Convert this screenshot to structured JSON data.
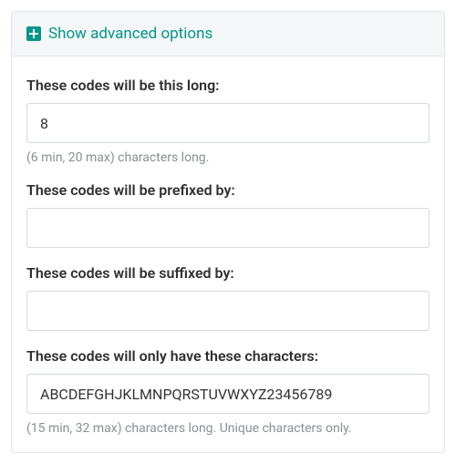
{
  "panel": {
    "toggle_label": "Show advanced options"
  },
  "fields": {
    "length": {
      "label": "These codes will be this long:",
      "value": "8",
      "help": "(6 min, 20 max) characters long."
    },
    "prefix": {
      "label": "These codes will be prefixed by:",
      "value": ""
    },
    "suffix": {
      "label": "These codes will be suffixed by:",
      "value": ""
    },
    "charset": {
      "label": "These codes will only have these characters:",
      "value": "ABCDEFGHJKLMNPQRSTUVWXYZ23456789",
      "help": "(15 min, 32 max) characters long. Unique characters only."
    }
  }
}
